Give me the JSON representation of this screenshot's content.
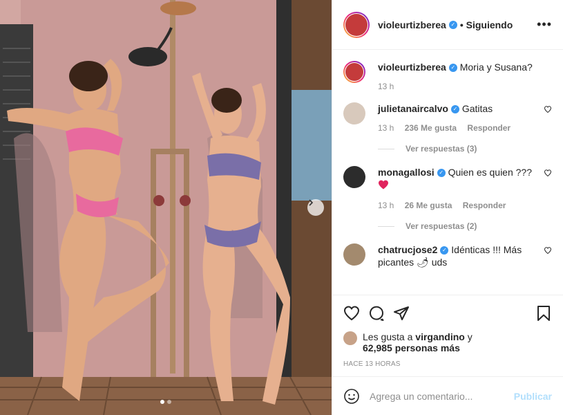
{
  "post": {
    "author": "violeurtizberea",
    "follow_status": "• Siguiendo",
    "more_icon": "more-options-icon",
    "carousel_dots": 2,
    "carousel_active": 1
  },
  "caption": {
    "user": "violeurtizberea",
    "text": "Moria y Susana?",
    "time": "13 h"
  },
  "comments": [
    {
      "user": "julietanaircalvo",
      "text": "Gatitas",
      "time": "13 h",
      "likes": "236 Me gusta",
      "reply": "Responder",
      "view_replies": "Ver respuestas (3)"
    },
    {
      "user": "monagallosi",
      "text": "Quien es quien ???",
      "emoji": "❤️",
      "time": "13 h",
      "likes": "26 Me gusta",
      "reply": "Responder",
      "view_replies": "Ver respuestas (2)"
    },
    {
      "user": "chatrucjose2",
      "text": "Idénticas !!! Más picantes 🌶 uds"
    }
  ],
  "likes": {
    "prefix": "Les gusta a",
    "user": "virgandino",
    "connector": "y",
    "count": "62,985 personas más"
  },
  "timestamp": "HACE 13 HORAS",
  "add_comment": {
    "placeholder": "Agrega un comentario...",
    "publish": "Publicar"
  },
  "colors": {
    "verified": "#3897f0",
    "publish_disabled": "#b2dffc",
    "heart_red": "#ed4956"
  }
}
